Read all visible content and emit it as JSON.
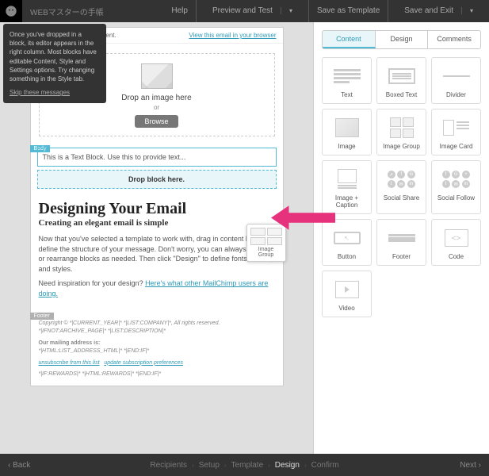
{
  "topbar": {
    "title": "WEBマスターの手帳",
    "actions": [
      "Help",
      "Preview and Test",
      "Save as Template",
      "Save and Exit"
    ]
  },
  "tooltip": {
    "text": "Once you've dropped in a block, its editor appears in the right column. Most blocks have editable Content, Style and Settings options. Try changing something in the Style tab.",
    "skip": "Skip these messages"
  },
  "email": {
    "preview_left": "view of your email's content.",
    "preview_right": "View this email in your browser",
    "image_block": {
      "line1": "Drop an image here",
      "line2": "or",
      "button": "Browse"
    },
    "body_tag": "Body",
    "text_block": "This is a Text Block. Use this to provide text...",
    "drop_zone": "Drop block here.",
    "heading": "Designing Your Email",
    "subheading": "Creating an elegant email is simple",
    "para1": "Now that you've selected a template to work with, drag in content blocks to define the structure of your message. Don't worry, you can always delete or rearrange blocks as needed. Then click \"Design\" to define fonts, colors, and styles.",
    "para2_a": "Need inspiration for your design? ",
    "para2_link": "Here's what other MailChimp users are doing.",
    "drag_ghost": "Image Group",
    "footer_tag": "Footer",
    "footer": {
      "copyright": "Copyright © *|CURRENT_YEAR|* *|LIST:COMPANY|*, All rights reserved.",
      "ifnot": "*|IFNOT:ARCHIVE_PAGE|* *|LIST:DESCRIPTION|*",
      "addr_label": "Our mailing address is:",
      "addr": "*|HTML:LIST_ADDRESS_HTML|* *|END:IF|*",
      "unsub": "unsubscribe from this list",
      "update": "update subscription preferences",
      "rewards": "*|IF:REWARDS|* *|HTML:REWARDS|* *|END:IF|*"
    }
  },
  "panel": {
    "tabs": [
      "Content",
      "Design",
      "Comments"
    ],
    "blocks": [
      "Text",
      "Boxed Text",
      "Divider",
      "Image",
      "Image Group",
      "Image Card",
      "Image + Caption",
      "Social Share",
      "Social Follow",
      "Button",
      "Footer",
      "Code",
      "Video"
    ]
  },
  "bottombar": {
    "back": "Back",
    "next": "Next",
    "steps": [
      "Recipients",
      "Setup",
      "Template",
      "Design",
      "Confirm"
    ],
    "active_step": "Design"
  }
}
